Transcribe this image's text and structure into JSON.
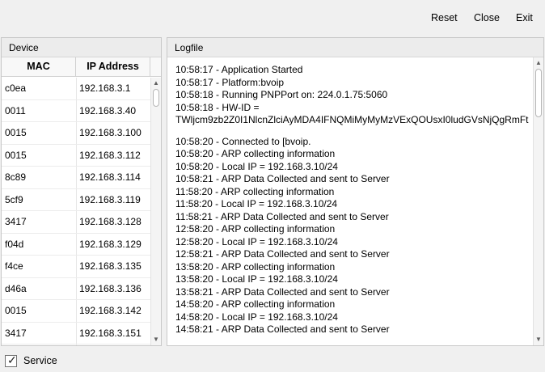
{
  "toolbar": {
    "reset_label": "Reset",
    "close_label": "Close",
    "exit_label": "Exit"
  },
  "device_panel": {
    "title": "Device",
    "columns": {
      "mac": "MAC",
      "ip": "IP Address"
    },
    "rows": [
      {
        "mac": "c0ea",
        "ip": "192.168.3.1"
      },
      {
        "mac": "0011",
        "ip": "192.168.3.40"
      },
      {
        "mac": "0015",
        "ip": "192.168.3.100"
      },
      {
        "mac": "0015",
        "ip": "192.168.3.112"
      },
      {
        "mac": "8c89",
        "ip": "192.168.3.114"
      },
      {
        "mac": "5cf9",
        "ip": "192.168.3.119"
      },
      {
        "mac": "3417",
        "ip": "192.168.3.128"
      },
      {
        "mac": "f04d",
        "ip": "192.168.3.129"
      },
      {
        "mac": "f4ce",
        "ip": "192.168.3.135"
      },
      {
        "mac": "d46a",
        "ip": "192.168.3.136"
      },
      {
        "mac": "0015",
        "ip": "192.168.3.142"
      },
      {
        "mac": "3417",
        "ip": "192.168.3.151"
      }
    ]
  },
  "log_panel": {
    "title": "Logfile",
    "lines": [
      "10:58:17 - Application Started",
      "10:58:17 - Platform:bvoip",
      "10:58:18 - Running PNPPort on: 224.0.1.75:5060",
      "10:58:18 - HW-ID =",
      "TWljcm9zb2Z0I1NlcnZlciAyMDA4IFNQMiMyMyMzVExQOUsxI0ludGVsNjQgRmFt",
      "",
      "10:58:20 - Connected to [bvoip.",
      "10:58:20 - ARP collecting information",
      "10:58:20 - Local IP = 192.168.3.10/24",
      "10:58:21 - ARP Data Collected and sent to Server",
      "11:58:20 - ARP collecting information",
      "11:58:20 - Local IP = 192.168.3.10/24",
      "11:58:21 - ARP Data Collected and sent to Server",
      "12:58:20 - ARP collecting information",
      "12:58:20 - Local IP = 192.168.3.10/24",
      "12:58:21 - ARP Data Collected and sent to Server",
      "13:58:20 - ARP collecting information",
      "13:58:20 - Local IP = 192.168.3.10/24",
      "13:58:21 - ARP Data Collected and sent to Server",
      "14:58:20 - ARP collecting information",
      "14:58:20 - Local IP = 192.168.3.10/24",
      "14:58:21 - ARP Data Collected and sent to Server"
    ]
  },
  "service": {
    "label": "Service",
    "checked": true
  }
}
